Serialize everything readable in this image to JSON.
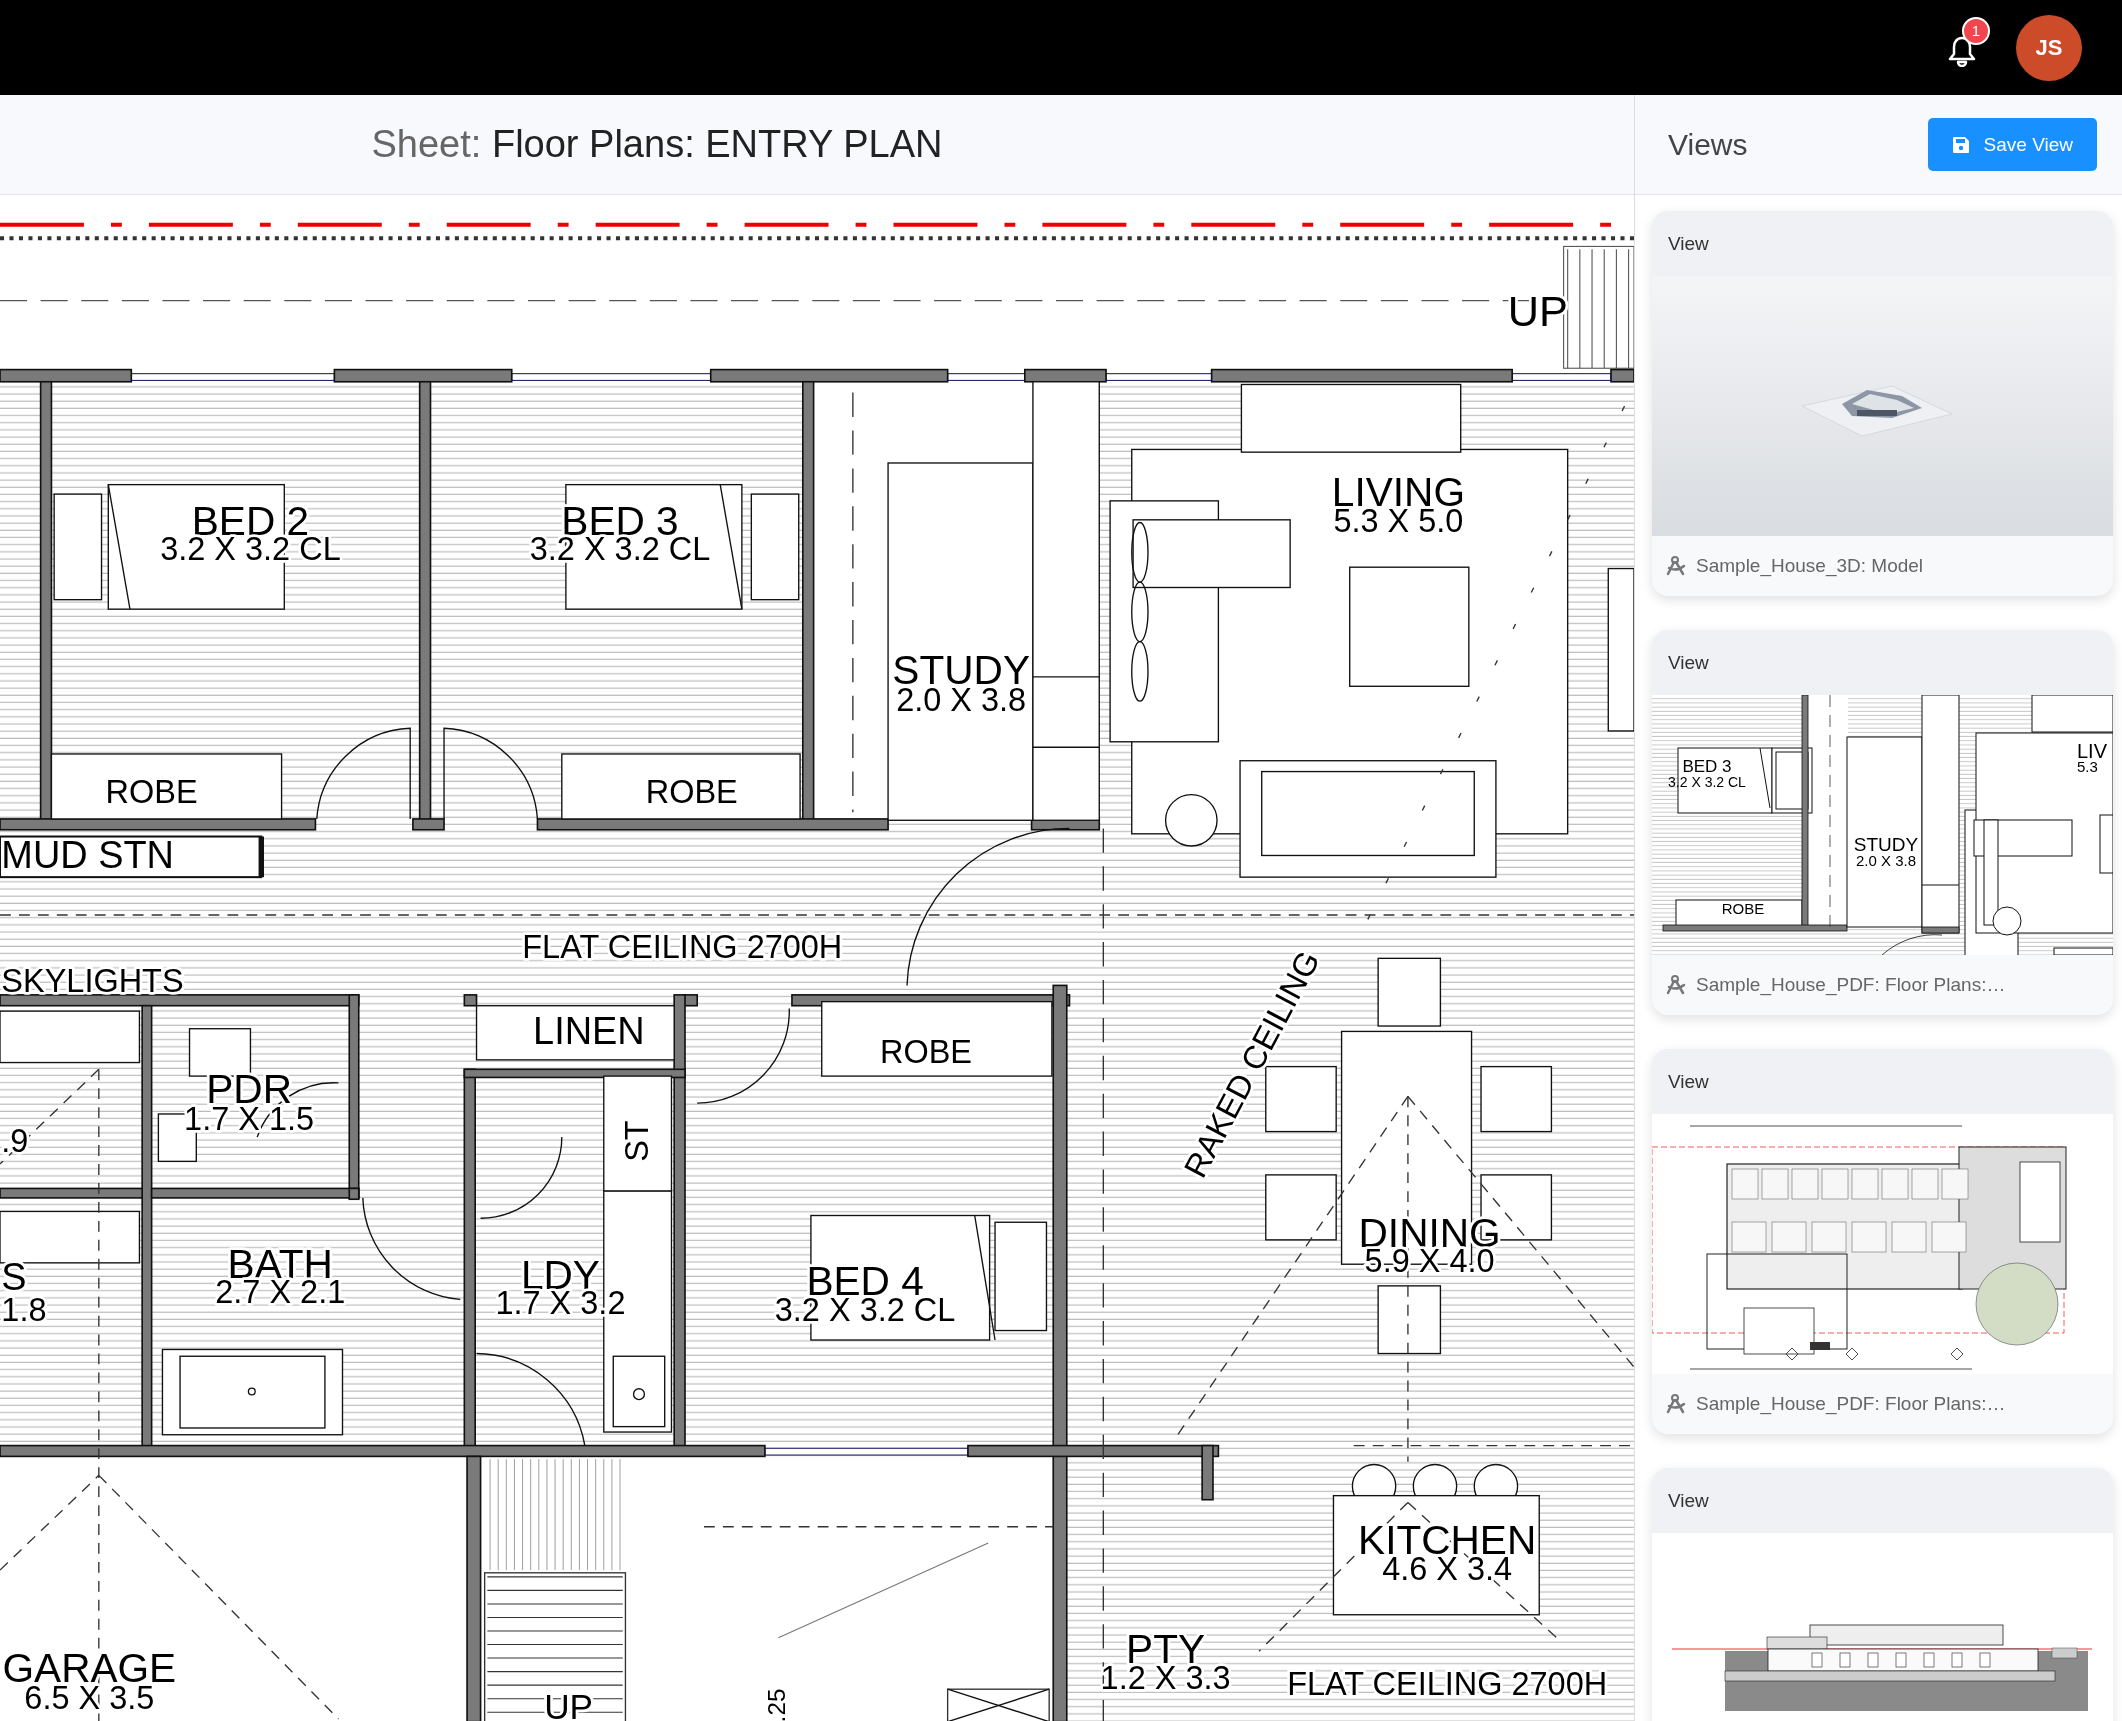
{
  "top_bar": {
    "notification_count": "1",
    "avatar_initials": "JS"
  },
  "sheet_header": {
    "label": "Sheet:",
    "title": "Floor Plans: ENTRY PLAN"
  },
  "plan": {
    "rooms": [
      {
        "name": "BED 2",
        "size": "3.2 X 3.2 CL"
      },
      {
        "name": "BED 3",
        "size": "3.2 X 3.2 CL"
      },
      {
        "name": "LIVING",
        "size": "5.3 X 5.0"
      },
      {
        "name": "STUDY",
        "size": "2.0 X 3.8"
      },
      {
        "name": "PDR",
        "size": "1.7 X 1.5"
      },
      {
        "name": "BATH",
        "size": "2.7 X 2.1"
      },
      {
        "name": "LDY",
        "size": "1.7 X 3.2"
      },
      {
        "name": "BED 4",
        "size": "3.2 X 3.2 CL"
      },
      {
        "name": "DINING",
        "size": "5.9 X 4.0"
      },
      {
        "name": "KITCHEN",
        "size": "4.6 X 3.4"
      },
      {
        "name": "PTY",
        "size": "1.2 X 3.3"
      },
      {
        "name": "GARAGE",
        "size": "6.5 X 3.5"
      }
    ],
    "labels": [
      "UP",
      "ROBE",
      "ROBE",
      "MUD STN",
      "FLAT CEILING 2700H",
      "SKYLIGHTS",
      "RAKED CEILING",
      "LINEN",
      "ROBE",
      "ST",
      ".9",
      "S",
      "1.8",
      "FLAT CEILING 2700H",
      ".25",
      "UP"
    ]
  },
  "views_panel": {
    "title": "Views",
    "save_button": "Save View",
    "cards": [
      {
        "header": "View",
        "kind": "model",
        "caption": "Sample_House_3D: Model"
      },
      {
        "header": "View",
        "kind": "plan-detail",
        "caption": "Sample_House_PDF: Floor Plans:…",
        "labels": [
          "BED 3",
          "3.2 X 3.2 CL",
          "ROBE",
          "STUDY",
          "2.0 X 3.8",
          "LIV",
          "5.3"
        ]
      },
      {
        "header": "View",
        "kind": "plan-overview",
        "caption": "Sample_House_PDF: Floor Plans:…"
      },
      {
        "header": "View",
        "kind": "elevation"
      }
    ]
  }
}
